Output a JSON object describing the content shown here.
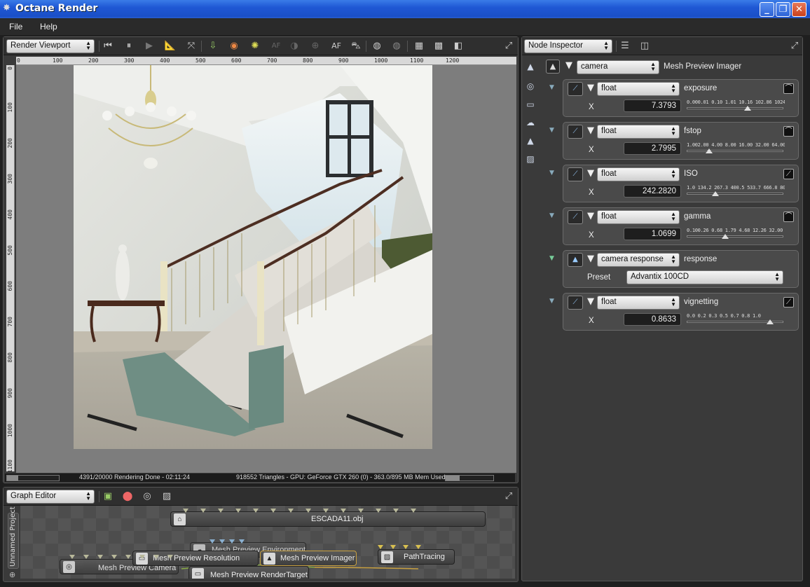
{
  "window": {
    "title": "Octane Render"
  },
  "menu": {
    "items": [
      "File",
      "Help"
    ]
  },
  "viewport": {
    "mode": "Render Viewport",
    "ruler_top": [
      "0",
      "100",
      "200",
      "300",
      "400",
      "500",
      "600",
      "700",
      "800",
      "900",
      "1000",
      "1100",
      "1200"
    ],
    "ruler_left": [
      "0",
      "100",
      "200",
      "300",
      "400",
      "500",
      "600",
      "700",
      "800",
      "900",
      "1000",
      "1100"
    ],
    "status_left": "4391/20000 Rendering Done - 02:11:24",
    "status_right": "918552 Triangles - GPU: GeForce GTX 260 (0) - 363.0/895 MB Mem Used",
    "render_progress": 0.22,
    "toolbar_text": {
      "af": "AF",
      "af2": "AF"
    }
  },
  "inspector": {
    "mode": "Node Inspector",
    "root": {
      "type": "camera",
      "label": "Mesh Preview Imager"
    },
    "params": [
      {
        "type": "float",
        "name": "exposure",
        "value": "7.3793",
        "ticks": "0.000.01  0.10  1.01  10.16 102.86 1024.00",
        "thumb": 0.63
      },
      {
        "type": "float",
        "name": "fstop",
        "value": "2.7995",
        "ticks": "1.002.00   4.00   8.00  16.00  32.00  64.00",
        "thumb": 0.23
      },
      {
        "type": "float",
        "name": "ISO",
        "value": "242.2820",
        "ticks": "1.0 134.2  267.3  400.5  533.7  666.8  800.0",
        "thumb": 0.3
      },
      {
        "type": "float",
        "name": "gamma",
        "value": "1.0699",
        "ticks": "0.100.26   0.68   1.79   4.68  12.26 32.00",
        "thumb": 0.4
      },
      {
        "type": "float",
        "name": "vignetting",
        "value": "0.8633",
        "ticks": "0.0  0.2   0.3   0.5   0.7   0.8  1.0",
        "thumb": 0.86
      }
    ],
    "response": {
      "type": "camera response",
      "name": "response",
      "preset_label": "Preset",
      "preset_value": "Advantix 100CD"
    },
    "x_label": "X"
  },
  "graph": {
    "mode": "Graph Editor",
    "project_tab": "Unnamed Project",
    "nodes": {
      "obj": "ESCADA11.obj",
      "env": "Mesh Preview Environment",
      "resolution": "Mesh Preview Resolution",
      "imager": "Mesh Preview Imager",
      "kernel": "PathTracing",
      "camera": "Mesh Preview Camera",
      "target": "Mesh Preview RenderTarget"
    }
  }
}
